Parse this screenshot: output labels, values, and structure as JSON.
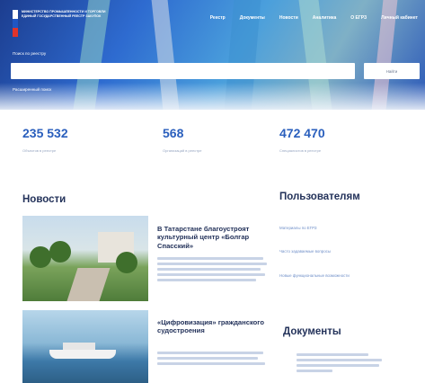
{
  "header": {
    "logo_text": "МИНИСТЕРСТВО ПРОМЫШЛЕННОСТИ И ТОРГОВЛИ ЕДИНЫЙ ГОСУДАРСТВЕННЫЙ РЕЕСТР ЗАКУПОК",
    "nav": [
      "Реестр",
      "Документы",
      "Новости",
      "Аналитика",
      "О ЕГРЗ",
      "Личный кабинет"
    ]
  },
  "search": {
    "label": "Поиск по реестру",
    "button": "Найти",
    "advanced": "Расширенный поиск"
  },
  "stats": [
    {
      "value": "235 532",
      "caption": "Объектов в реестре"
    },
    {
      "value": "568",
      "caption": "Организаций в реестре"
    },
    {
      "value": "472 470",
      "caption": "Специалистов в реестре"
    }
  ],
  "news": {
    "title": "Новости",
    "items": [
      {
        "headline": "В Татарстане благоустроят культурный центр «Болгар Спасский»"
      },
      {
        "headline": "«Цифровизация» гражданского судостроения"
      }
    ]
  },
  "users": {
    "title": "Пользователям",
    "links": [
      "Материалы по ЕГРЗ",
      "Часто задаваемые вопросы",
      "Новые функциональные возможности"
    ]
  },
  "documents": {
    "title": "Документы"
  }
}
